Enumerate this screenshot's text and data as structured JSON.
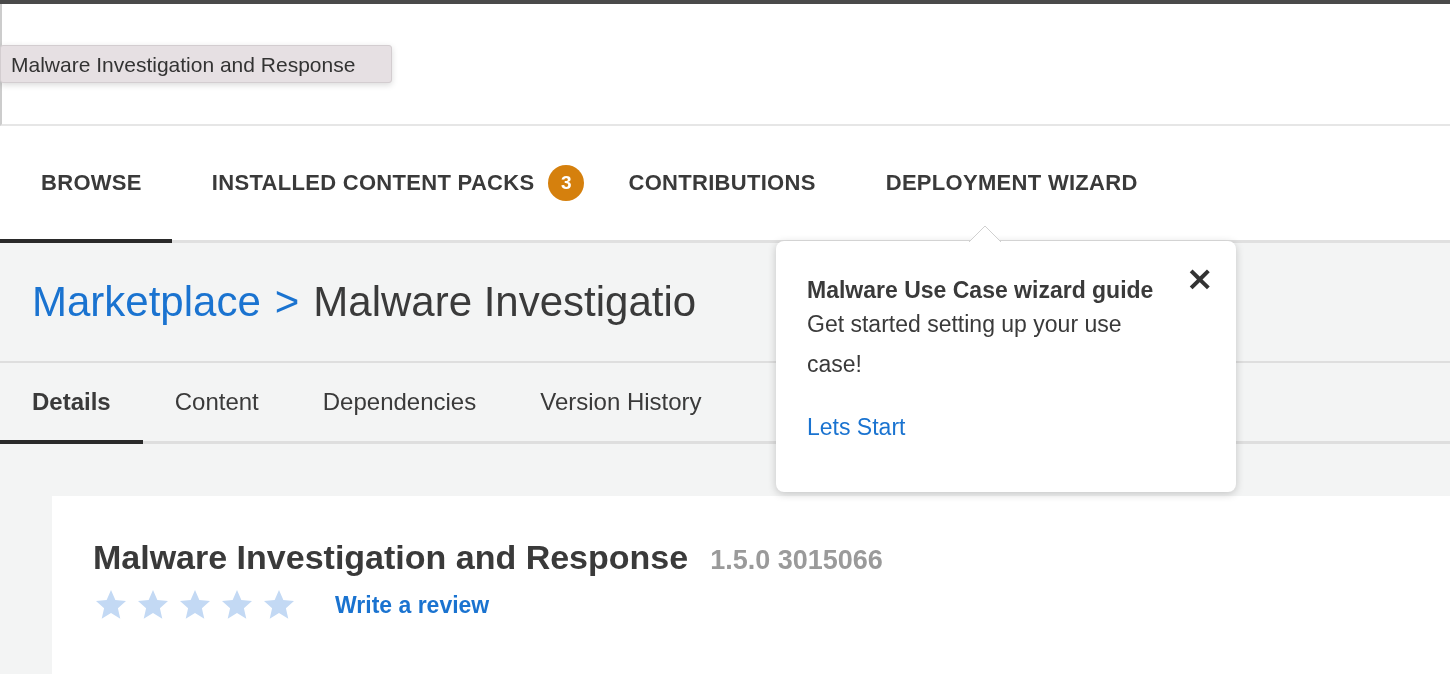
{
  "tooltip": {
    "text": "Malware Investigation and Response"
  },
  "tabs": [
    {
      "label": "BROWSE",
      "selected": true
    },
    {
      "label": "INSTALLED CONTENT PACKS",
      "selected": false,
      "badge": "3"
    },
    {
      "label": "CONTRIBUTIONS",
      "selected": false
    },
    {
      "label": "DEPLOYMENT WIZARD",
      "selected": false
    }
  ],
  "breadcrumb": {
    "link": "Marketplace",
    "separator": ">",
    "current": "Malware Investigatio"
  },
  "subtabs": [
    {
      "label": "Details",
      "selected": true
    },
    {
      "label": "Content",
      "selected": false
    },
    {
      "label": "Dependencies",
      "selected": false
    },
    {
      "label": "Version History",
      "selected": false
    }
  ],
  "popover": {
    "title": "Malware Use Case wizard guide",
    "body": "Get started setting up your use case!",
    "link": "Lets Start",
    "close": "×"
  },
  "card": {
    "title": "Malware Investigation and Response",
    "version": "1.5.0 3015066",
    "stars": 5,
    "review_link": "Write a review"
  }
}
